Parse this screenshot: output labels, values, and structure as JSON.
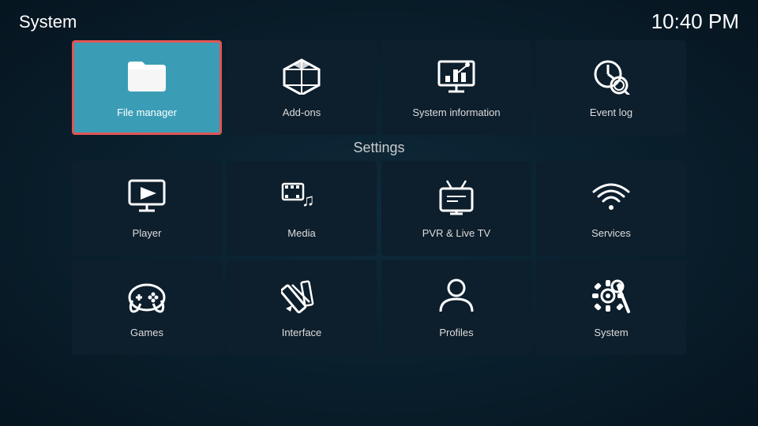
{
  "header": {
    "title": "System",
    "clock": "10:40 PM"
  },
  "top_row": [
    {
      "id": "file-manager",
      "label": "File manager",
      "selected": true
    },
    {
      "id": "add-ons",
      "label": "Add-ons",
      "selected": false
    },
    {
      "id": "system-information",
      "label": "System information",
      "selected": false
    },
    {
      "id": "event-log",
      "label": "Event log",
      "selected": false
    }
  ],
  "settings_label": "Settings",
  "settings_row1": [
    {
      "id": "player",
      "label": "Player"
    },
    {
      "id": "media",
      "label": "Media"
    },
    {
      "id": "pvr-live-tv",
      "label": "PVR & Live TV"
    },
    {
      "id": "services",
      "label": "Services"
    }
  ],
  "settings_row2": [
    {
      "id": "games",
      "label": "Games"
    },
    {
      "id": "interface",
      "label": "Interface"
    },
    {
      "id": "profiles",
      "label": "Profiles"
    },
    {
      "id": "system",
      "label": "System"
    }
  ]
}
